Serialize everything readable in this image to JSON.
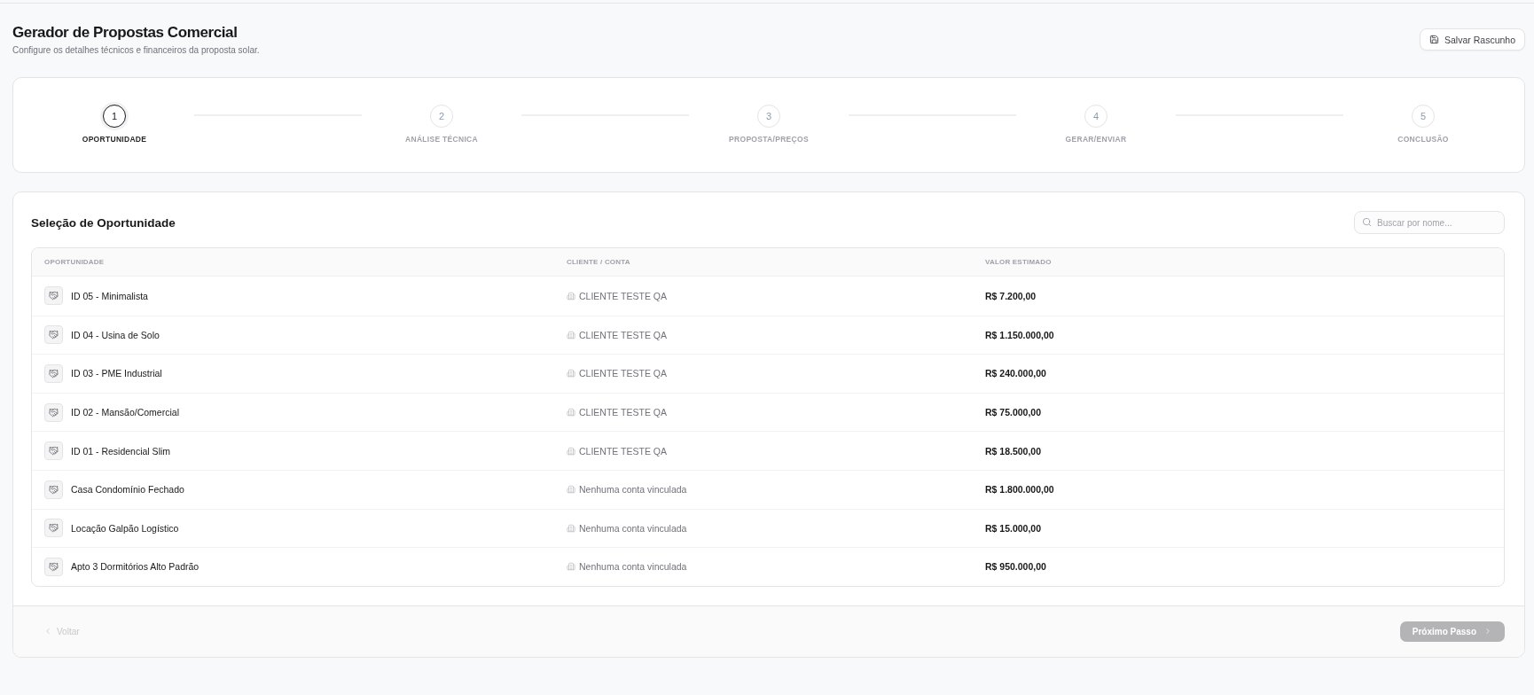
{
  "header": {
    "title": "Gerador de Propostas Comercial",
    "subtitle": "Configure os detalhes técnicos e financeiros da proposta solar.",
    "save_button": {
      "label": "Salvar Rascunho"
    }
  },
  "stepper": {
    "steps": [
      {
        "number": "1",
        "label": "OPORTUNIDADE",
        "selected": true
      },
      {
        "number": "2",
        "label": "ANÁLISE TÉCNICA",
        "selected": false
      },
      {
        "number": "3",
        "label": "PROPOSTA/PREÇOS",
        "selected": false
      },
      {
        "number": "4",
        "label": "GERAR/ENVIAR",
        "selected": false
      },
      {
        "number": "5",
        "label": "CONCLUSÃO",
        "selected": false
      }
    ]
  },
  "selection_card": {
    "title": "Seleção de Oportunidade",
    "search": {
      "placeholder": "Buscar por nome..."
    },
    "table": {
      "columns": [
        "OPORTUNIDADE",
        "CLIENTE / CONTA",
        "VALOR ESTIMADO"
      ],
      "rows": [
        {
          "opportunity": "ID 05 - Minimalista",
          "client": "CLIENTE TESTE QA",
          "value": "R$ 7.200,00"
        },
        {
          "opportunity": "ID 04 - Usina de Solo",
          "client": "CLIENTE TESTE QA",
          "value": "R$ 1.150.000,00"
        },
        {
          "opportunity": "ID 03 - PME Industrial",
          "client": "CLIENTE TESTE QA",
          "value": "R$ 240.000,00"
        },
        {
          "opportunity": "ID 02 - Mansão/Comercial",
          "client": "CLIENTE TESTE QA",
          "value": "R$ 75.000,00"
        },
        {
          "opportunity": "ID 01 - Residencial Slim",
          "client": "CLIENTE TESTE QA",
          "value": "R$ 18.500,00"
        },
        {
          "opportunity": "Casa Condomínio Fechado",
          "client": "Nenhuma conta vinculada",
          "value": "R$ 1.800.000,00"
        },
        {
          "opportunity": "Locação Galpão Logístico",
          "client": "Nenhuma conta vinculada",
          "value": "R$ 15.000,00"
        },
        {
          "opportunity": "Apto 3 Dormitórios Alto Padrão",
          "client": "Nenhuma conta vinculada",
          "value": "R$ 950.000,00"
        }
      ]
    }
  },
  "footer": {
    "back_button": {
      "label": "Voltar",
      "disabled": true
    },
    "next_button": {
      "label": "Próximo Passo",
      "disabled": true
    }
  }
}
